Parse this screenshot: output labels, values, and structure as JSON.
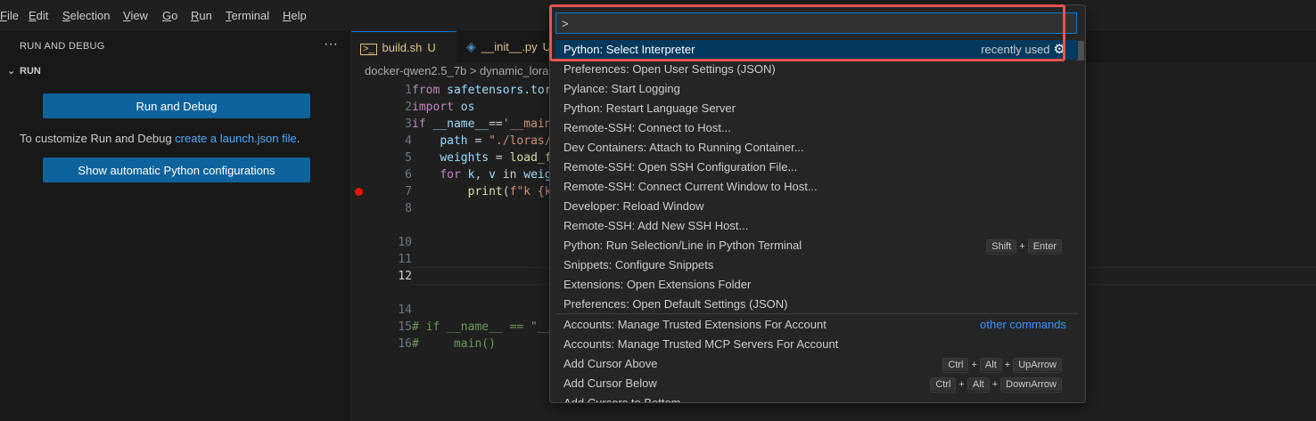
{
  "menubar": {
    "items": [
      {
        "key": "F",
        "rest": "ile"
      },
      {
        "key": "E",
        "rest": "dit"
      },
      {
        "key": "S",
        "rest": "election"
      },
      {
        "key": "V",
        "rest": "iew"
      },
      {
        "key": "G",
        "rest": "o"
      },
      {
        "key": "R",
        "rest": "un"
      },
      {
        "key": "T",
        "rest": "erminal"
      },
      {
        "key": "H",
        "rest": "elp"
      }
    ]
  },
  "sidebar": {
    "title": "RUN AND DEBUG",
    "more": "···",
    "section": "RUN",
    "run_button": "Run and Debug",
    "customize_prefix": "To customize Run and Debug ",
    "customize_link": "create a launch.json file",
    "customize_suffix": ".",
    "show_button": "Show automatic Python configurations"
  },
  "tabs": [
    {
      "name": "build.sh",
      "status": "U",
      "icon": "terminal-file-icon"
    },
    {
      "name": "__init__.py",
      "status": "U",
      "icon": "python-file-icon"
    }
  ],
  "breadcrumb": {
    "path": "docker-qwen2.5_7b",
    "sep": ">",
    "current": "dynamic_lora"
  },
  "editor": {
    "lines": [
      {
        "n": "1",
        "tokens": [
          [
            "kw",
            "from "
          ],
          [
            "var",
            "safetensors.tor"
          ]
        ]
      },
      {
        "n": "2",
        "tokens": [
          [
            "kw",
            "import "
          ],
          [
            "var",
            "os"
          ]
        ]
      },
      {
        "n": "3",
        "tokens": [
          [
            "kw",
            "if "
          ],
          [
            "var",
            "__name__"
          ],
          [
            "tx",
            "=="
          ],
          [
            "str",
            "'__main"
          ]
        ]
      },
      {
        "n": "4",
        "tokens": [
          [
            "tx",
            "    "
          ],
          [
            "var",
            "path"
          ],
          [
            "tx",
            " = "
          ],
          [
            "str",
            "\"./loras/"
          ]
        ]
      },
      {
        "n": "5",
        "tokens": [
          [
            "tx",
            "    "
          ],
          [
            "var",
            "weights"
          ],
          [
            "tx",
            " = "
          ],
          [
            "fn",
            "load_f"
          ]
        ]
      },
      {
        "n": "6",
        "tokens": [
          [
            "tx",
            "    "
          ],
          [
            "kw",
            "for "
          ],
          [
            "var",
            "k"
          ],
          [
            "tx",
            ", "
          ],
          [
            "var",
            "v"
          ],
          [
            "tx",
            " in "
          ],
          [
            "var",
            "weig"
          ]
        ]
      },
      {
        "n": "7",
        "tokens": [
          [
            "tx",
            "        "
          ],
          [
            "fn",
            "print"
          ],
          [
            "tx",
            "("
          ],
          [
            "str",
            "f\"k {k"
          ]
        ]
      },
      {
        "n": "8",
        "tokens": []
      },
      {
        "n": "10",
        "tokens": []
      },
      {
        "n": "11",
        "tokens": []
      },
      {
        "n": "12",
        "tokens": []
      },
      {
        "n": "14",
        "tokens": []
      },
      {
        "n": "15",
        "tokens": [
          [
            "cm",
            "# if __name__ == \"__"
          ]
        ]
      },
      {
        "n": "16",
        "tokens": [
          [
            "cm",
            "#     main()"
          ]
        ]
      }
    ]
  },
  "palette": {
    "input_value": ">",
    "items": [
      {
        "label": "Python: Select Interpreter",
        "hint": "recently used",
        "gear": "⚙",
        "selected": true
      },
      {
        "label": "Preferences: Open User Settings (JSON)"
      },
      {
        "label": "Pylance: Start Logging"
      },
      {
        "label": "Python: Restart Language Server"
      },
      {
        "label": "Remote-SSH: Connect to Host..."
      },
      {
        "label": "Dev Containers: Attach to Running Container..."
      },
      {
        "label": "Remote-SSH: Open SSH Configuration File..."
      },
      {
        "label": "Remote-SSH: Connect Current Window to Host..."
      },
      {
        "label": "Developer: Reload Window"
      },
      {
        "label": "Remote-SSH: Add New SSH Host..."
      },
      {
        "label": "Python: Run Selection/Line in Python Terminal",
        "keys": [
          "Shift",
          "Enter"
        ]
      },
      {
        "label": "Snippets: Configure Snippets"
      },
      {
        "label": "Extensions: Open Extensions Folder"
      },
      {
        "label": "Preferences: Open Default Settings (JSON)"
      },
      {
        "label": "Accounts: Manage Trusted Extensions For Account",
        "link": "other commands"
      },
      {
        "label": "Accounts: Manage Trusted MCP Servers For Account"
      },
      {
        "label": "Add Cursor Above",
        "keys": [
          "Ctrl",
          "Alt",
          "UpArrow"
        ]
      },
      {
        "label": "Add Cursor Below",
        "keys": [
          "Ctrl",
          "Alt",
          "DownArrow"
        ]
      },
      {
        "label": "Add Cursors to Bottom"
      }
    ]
  },
  "colors": {
    "accent": "#0078d4",
    "button": "#0e639c",
    "highlight_box": "#e8534e",
    "breakpoint": "#e51400"
  }
}
